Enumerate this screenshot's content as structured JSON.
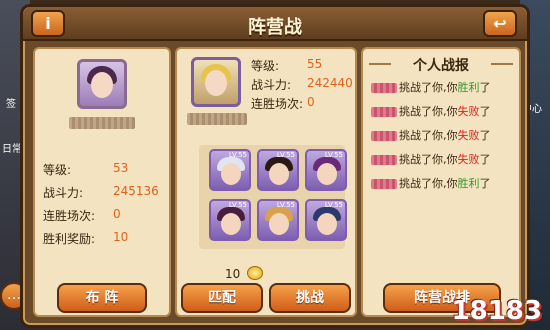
{
  "window": {
    "title": "阵营战",
    "info_icon": "i",
    "back_icon": "↩"
  },
  "sidebar_left": {
    "tags": [
      "签",
      "日常"
    ]
  },
  "sidebar_right": {
    "tags": [
      "中心"
    ]
  },
  "self_panel": {
    "avatar": "female-hero-portrait",
    "stats": [
      {
        "label": "等级:",
        "value": "53"
      },
      {
        "label": "战斗力:",
        "value": "245136"
      },
      {
        "label": "连胜场次:",
        "value": "0"
      },
      {
        "label": "胜利奖励:",
        "value": "10"
      }
    ],
    "formation_button": "布 阵"
  },
  "opponent_panel": {
    "avatar": "blonde-hero-portrait",
    "stats": [
      {
        "label": "等级:",
        "value": "55"
      },
      {
        "label": "战斗力:",
        "value": "242440"
      },
      {
        "label": "连胜场次:",
        "value": "0"
      }
    ],
    "heroes": [
      {
        "level": "LV.55",
        "hair": "#dfe6f2",
        "bg": "#c9b3ea"
      },
      {
        "level": "LV.55",
        "hair": "#2a1a14",
        "bg": "#8a6acd"
      },
      {
        "level": "LV.55",
        "hair": "#6a2a7a",
        "bg": "#9b78d4"
      },
      {
        "level": "LV.55",
        "hair": "#4a1e3a",
        "bg": "#b89ae0"
      },
      {
        "level": "LV.55",
        "hair": "#d8a14a",
        "bg": "#a78ad6"
      },
      {
        "level": "LV.55",
        "hair": "#2b3a6a",
        "bg": "#8f74c8"
      }
    ],
    "reward_amount": "10",
    "match_button": "匹配",
    "challenge_button": "挑战"
  },
  "battle_log": {
    "title": "个人战报",
    "entries": [
      {
        "text": "挑战了你,你",
        "result": "胜利",
        "tail": "了",
        "type": "win"
      },
      {
        "text": "挑战了你,你",
        "result": "失败",
        "tail": "了",
        "type": "lose"
      },
      {
        "text": "挑战了你,你",
        "result": "失败",
        "tail": "了",
        "type": "lose"
      },
      {
        "text": "挑战了你,你",
        "result": "失败",
        "tail": "了",
        "type": "lose"
      },
      {
        "text": "挑战了你,你",
        "result": "胜利",
        "tail": "了",
        "type": "win"
      }
    ],
    "ranking_button": "阵营战排"
  },
  "watermark": "18183",
  "colors": {
    "accent": "#e0631b",
    "win": "#2e9a2e",
    "lose": "#e3221c",
    "panel": "#f3e3c0"
  }
}
